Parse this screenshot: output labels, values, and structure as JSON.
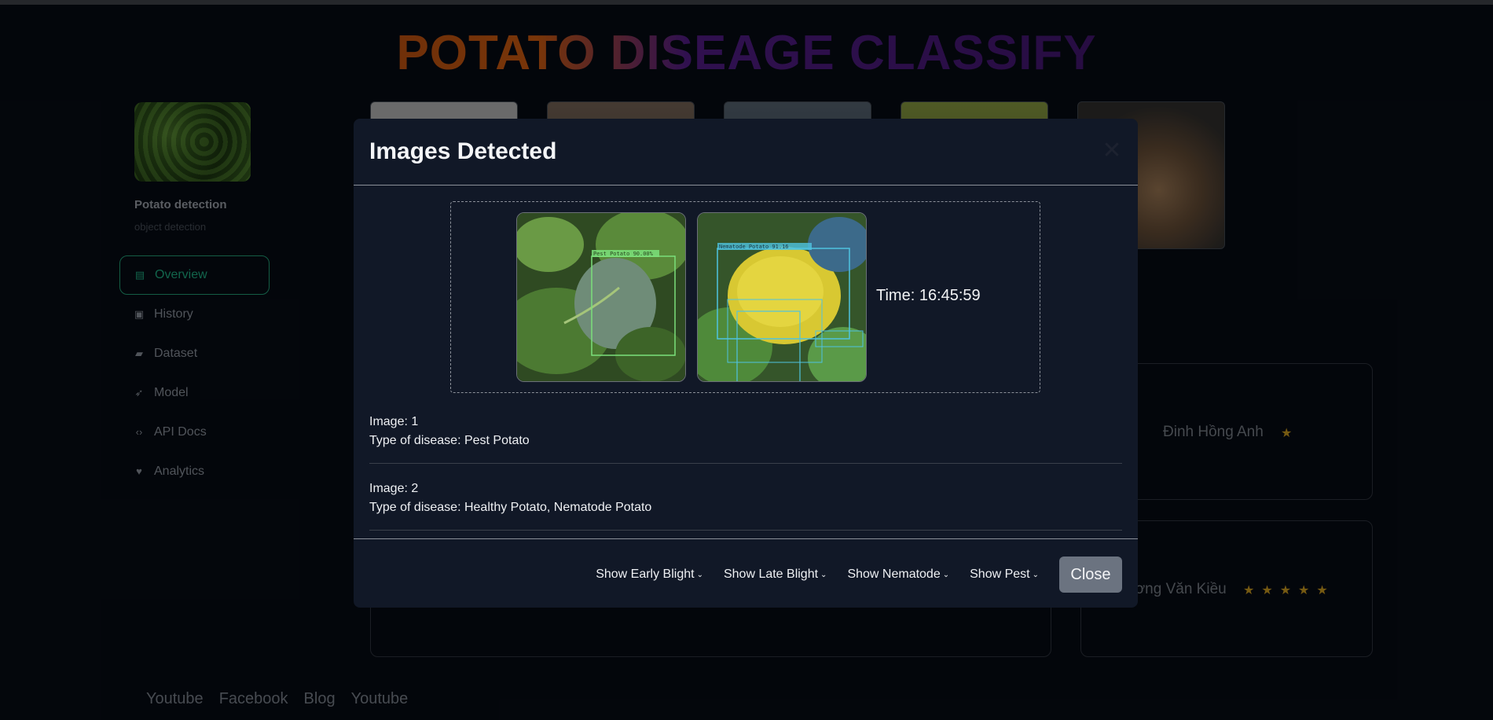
{
  "header": {
    "title": "POTATO DISEAGE CLASSIFY"
  },
  "sidebar": {
    "app_name": "Potato detection",
    "app_subtitle": "object detection",
    "items": [
      {
        "label": "Overview",
        "icon": "book-icon",
        "active": true
      },
      {
        "label": "History",
        "icon": "image-icon",
        "active": false
      },
      {
        "label": "Dataset",
        "icon": "folder-icon",
        "active": false
      },
      {
        "label": "Model",
        "icon": "rocket-icon",
        "active": false
      },
      {
        "label": "API Docs",
        "icon": "code-icon",
        "active": false
      },
      {
        "label": "Analytics",
        "icon": "heart-pulse-icon",
        "active": false
      }
    ]
  },
  "reviews": [
    {
      "name": "Đinh Hồng Anh",
      "stars": 1
    },
    {
      "name": "ương Văn Kiều",
      "stars": 5
    }
  ],
  "footer_links": [
    "Youtube",
    "Facebook",
    "Blog",
    "Youtube"
  ],
  "modal": {
    "title": "Images Detected",
    "time": "Time: 16:45:59",
    "detections": [
      {
        "box_label": "Pest Potato 90.00%"
      },
      {
        "box_label": "Nematode Potato 91.16"
      }
    ],
    "results": [
      {
        "image": "Image: 1",
        "disease": "Type of disease: Pest Potato"
      },
      {
        "image": "Image: 2",
        "disease": "Type of disease: Healthy Potato, Nematode Potato"
      }
    ],
    "toggles": [
      "Show Early Blight",
      "Show Late Blight",
      "Show Nematode",
      "Show Pest"
    ],
    "close_label": "Close"
  },
  "colors": {
    "accent": "#1c9c75",
    "star": "#b58a1c",
    "modal_bg": "#111827"
  }
}
